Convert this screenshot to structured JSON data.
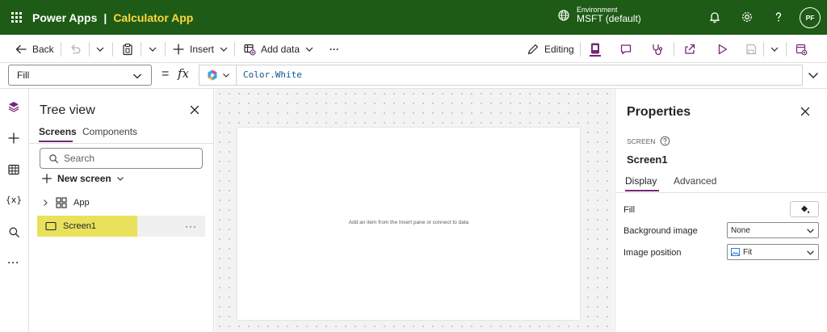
{
  "header": {
    "brand": "Power Apps",
    "separator": "|",
    "app_name": "Calculator App",
    "environment_label": "Environment",
    "environment_value": "MSFT (default)",
    "avatar_initials": "PF",
    "colors": {
      "header_bg": "#1e5b16",
      "app_name": "#ffd83d"
    }
  },
  "toolbar": {
    "back_label": "Back",
    "insert_label": "Insert",
    "add_data_label": "Add data",
    "more_label": "···",
    "editing_label": "Editing"
  },
  "formula_bar": {
    "property": "Fill",
    "equals": "=",
    "fx": "fx",
    "formula": "Color.White"
  },
  "tree_view": {
    "title": "Tree view",
    "tabs": [
      "Screens",
      "Components"
    ],
    "search_placeholder": "Search",
    "new_screen_label": "New screen",
    "app_label": "App",
    "screen_label": "Screen1",
    "screen_more": "···"
  },
  "canvas": {
    "hint": "Add an item from the Insert pane or connect to data"
  },
  "properties": {
    "title": "Properties",
    "type_label": "SCREEN",
    "name": "Screen1",
    "tabs": [
      "Display",
      "Advanced"
    ],
    "fill_label": "Fill",
    "background_image_label": "Background image",
    "background_image_value": "None",
    "image_position_label": "Image position",
    "image_position_value": "Fit"
  }
}
